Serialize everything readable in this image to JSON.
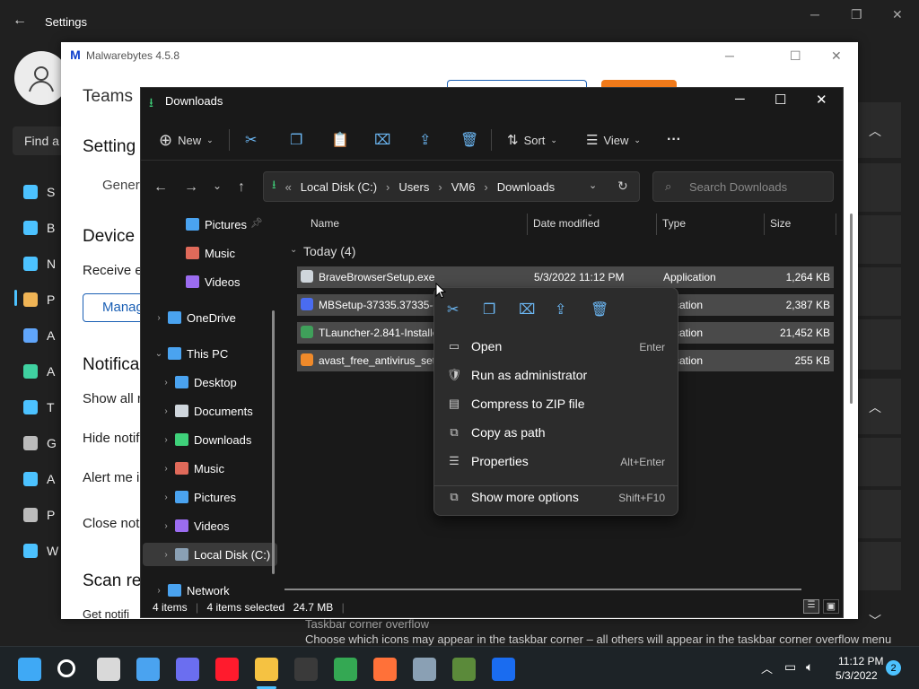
{
  "settings": {
    "title": "Settings",
    "search_placeholder": "Find a",
    "nav": [
      {
        "label": "S",
        "icon": "system-icon",
        "color": "#4cc2ff"
      },
      {
        "label": "B",
        "icon": "bluetooth-icon",
        "color": "#4cc2ff"
      },
      {
        "label": "N",
        "icon": "network-icon",
        "color": "#4cc2ff"
      },
      {
        "label": "P",
        "icon": "personalization-icon",
        "color": "#f0b455"
      },
      {
        "label": "A",
        "icon": "apps-icon",
        "color": "#60a5fa"
      },
      {
        "label": "A",
        "icon": "accounts-icon",
        "color": "#3fd1a0"
      },
      {
        "label": "T",
        "icon": "time-icon",
        "color": "#4cc2ff"
      },
      {
        "label": "G",
        "icon": "gaming-icon",
        "color": "#bbbbbb"
      },
      {
        "label": "A",
        "icon": "accessibility-icon",
        "color": "#4cc2ff"
      },
      {
        "label": "P",
        "icon": "privacy-icon",
        "color": "#bbbbbb"
      },
      {
        "label": "W",
        "icon": "windows-update-icon",
        "color": "#4cc2ff"
      }
    ],
    "bottom_line1": "Taskbar corner overflow",
    "bottom_line2": "Choose which icons may appear in the taskbar corner – all others will appear in the taskbar corner overflow menu"
  },
  "mb": {
    "title": "Malwarebytes 4.5.8",
    "teams": "Teams",
    "settings": "Setting",
    "general": "Gener",
    "device": "Device",
    "receive": "Receive e",
    "manage": "Manag",
    "notifications": "Notifica",
    "show_all": "Show all r",
    "hide_notif": "Hide notif",
    "alert_me": "Alert me i",
    "close_noti": "Close noti",
    "scan_re": "Scan re",
    "get_notif": "Get notifi"
  },
  "explorer": {
    "title": "Downloads",
    "toolbar": {
      "new": "New",
      "sort": "Sort",
      "view": "View",
      "more": "···"
    },
    "address": {
      "overflow": "«",
      "crumbs": [
        "Local Disk (C:)",
        "Users",
        "VM6",
        "Downloads"
      ]
    },
    "search_placeholder": "Search Downloads",
    "sidebar": [
      {
        "label": "Pictures",
        "icon": "pictures-icon",
        "color": "#4aa3f0",
        "chev": "",
        "indent": 28,
        "pin": true
      },
      {
        "label": "Music",
        "icon": "music-icon",
        "color": "#e06a5a",
        "chev": "",
        "indent": 28
      },
      {
        "label": "Videos",
        "icon": "videos-icon",
        "color": "#9b6cf0",
        "chev": "",
        "indent": 28
      },
      {
        "label": "OneDrive",
        "icon": "onedrive-icon",
        "color": "#4aa3f0",
        "chev": "›",
        "indent": 8
      },
      {
        "label": "This PC",
        "icon": "this-pc-icon",
        "color": "#4aa3f0",
        "chev": "⌄",
        "indent": 8
      },
      {
        "label": "Desktop",
        "icon": "desktop-icon",
        "color": "#4aa3f0",
        "chev": "›",
        "indent": 16
      },
      {
        "label": "Documents",
        "icon": "documents-icon",
        "color": "#cfd6dc",
        "chev": "›",
        "indent": 16
      },
      {
        "label": "Downloads",
        "icon": "downloads-icon",
        "color": "#3fd17a",
        "chev": "›",
        "indent": 16
      },
      {
        "label": "Music",
        "icon": "music-icon",
        "color": "#e06a5a",
        "chev": "›",
        "indent": 16
      },
      {
        "label": "Pictures",
        "icon": "pictures-icon",
        "color": "#4aa3f0",
        "chev": "›",
        "indent": 16
      },
      {
        "label": "Videos",
        "icon": "videos-icon",
        "color": "#9b6cf0",
        "chev": "›",
        "indent": 16
      },
      {
        "label": "Local Disk (C:)",
        "icon": "local-disk-icon",
        "color": "#8aa0b4",
        "chev": "›",
        "indent": 16,
        "selected": true
      },
      {
        "label": "Network",
        "icon": "network-icon",
        "color": "#4aa3f0",
        "chev": "›",
        "indent": 8
      }
    ],
    "columns": {
      "name": "Name",
      "date": "Date modified",
      "type": "Type",
      "size": "Size"
    },
    "group": "Today (4)",
    "files": [
      {
        "name": "BraveBrowserSetup.exe",
        "date": "5/3/2022 11:12 PM",
        "type": "Application",
        "size": "1,264 KB",
        "icon": "brave-file-icon",
        "color": "#cfd6dc"
      },
      {
        "name": "MBSetup-37335.37335-c",
        "date": "",
        "type": "plication",
        "size": "2,387 KB",
        "icon": "malwarebytes-file-icon",
        "color": "#4a6cf0"
      },
      {
        "name": "TLauncher-2.841-Installe",
        "date": "",
        "type": "plication",
        "size": "21,452 KB",
        "icon": "tlauncher-file-icon",
        "color": "#3fa05a"
      },
      {
        "name": "avast_free_antivirus_setu",
        "date": "",
        "type": "plication",
        "size": "255 KB",
        "icon": "avast-file-icon",
        "color": "#f08a2a"
      }
    ],
    "status": {
      "items": "4 items",
      "selected": "4 items selected",
      "size": "24.7 MB"
    }
  },
  "context_menu": {
    "items": [
      {
        "label": "Open",
        "shortcut": "Enter",
        "icon": "open-icon"
      },
      {
        "label": "Run as administrator",
        "shortcut": "",
        "icon": "run-as-admin-icon"
      },
      {
        "label": "Compress to ZIP file",
        "shortcut": "",
        "icon": "zip-icon"
      },
      {
        "label": "Copy as path",
        "shortcut": "",
        "icon": "copy-path-icon"
      },
      {
        "label": "Properties",
        "shortcut": "Alt+Enter",
        "icon": "properties-icon"
      }
    ],
    "more": {
      "label": "Show more options",
      "shortcut": "Shift+F10"
    }
  },
  "taskbar": {
    "apps": [
      {
        "icon": "start-icon",
        "color": "#3fa9f5"
      },
      {
        "icon": "search-icon",
        "color": "#ffffff"
      },
      {
        "icon": "task-view-icon",
        "color": "#d9d9d9"
      },
      {
        "icon": "widgets-icon",
        "color": "#4aa3f0"
      },
      {
        "icon": "chat-icon",
        "color": "#6b6ef0"
      },
      {
        "icon": "opera-icon",
        "color": "#ff1b2d"
      },
      {
        "icon": "file-explorer-icon",
        "color": "#f5c242"
      },
      {
        "icon": "store-icon",
        "color": "#3a3a3a"
      },
      {
        "icon": "chrome-icon",
        "color": "#34a853"
      },
      {
        "icon": "firefox-icon",
        "color": "#ff7139"
      },
      {
        "icon": "settings-app-icon",
        "color": "#8aa0b4"
      },
      {
        "icon": "minecraft-icon",
        "color": "#5b8a3a"
      },
      {
        "icon": "malwarebytes-app-icon",
        "color": "#1a6cf0"
      }
    ],
    "time": "11:12 PM",
    "date": "5/3/2022",
    "notification_count": "2"
  }
}
